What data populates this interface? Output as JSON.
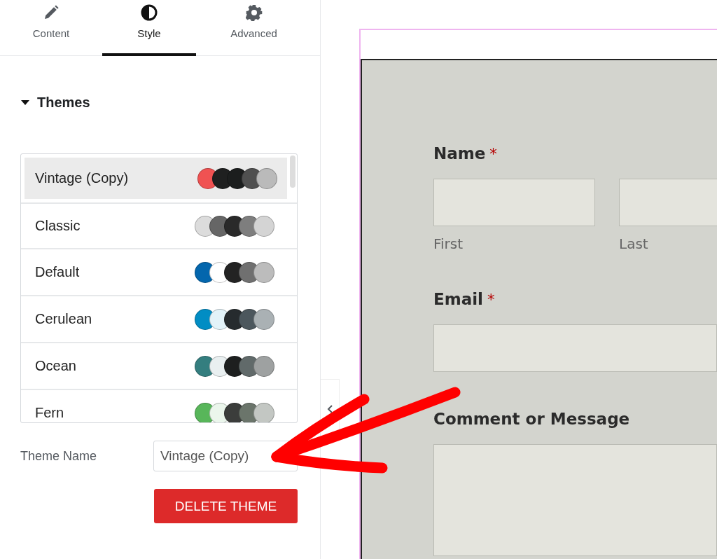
{
  "tabs": [
    {
      "label": "Content",
      "selected": false
    },
    {
      "label": "Style",
      "selected": true
    },
    {
      "label": "Advanced",
      "selected": false
    }
  ],
  "section": {
    "title": "Themes",
    "expanded": true
  },
  "themes": [
    {
      "name": "Vintage (Copy)",
      "selected": true,
      "swatches": [
        {
          "color": "#f05252"
        },
        {
          "color": "#1f2020"
        },
        {
          "color": "#1c1e1e"
        },
        {
          "color": "#505050"
        },
        {
          "color": "#bababa"
        }
      ]
    },
    {
      "name": "Classic",
      "selected": false,
      "swatches": [
        {
          "color": "#dcdcdc"
        },
        {
          "color": "#666666"
        },
        {
          "color": "#2a2a2a"
        },
        {
          "color": "#7e7e7e"
        },
        {
          "color": "#d4d4d4"
        }
      ]
    },
    {
      "name": "Default",
      "selected": false,
      "swatches": [
        {
          "color": "#0366ad"
        },
        {
          "color": "#ffffff"
        },
        {
          "color": "#232323"
        },
        {
          "color": "#707070"
        },
        {
          "color": "#bcbcbc"
        }
      ]
    },
    {
      "name": "Cerulean",
      "selected": false,
      "swatches": [
        {
          "color": "#018dc4"
        },
        {
          "color": "#e3f3f9"
        },
        {
          "color": "#262b2e"
        },
        {
          "color": "#4c575d"
        },
        {
          "color": "#aab1b4"
        }
      ]
    },
    {
      "name": "Ocean",
      "selected": false,
      "swatches": [
        {
          "color": "#347e7f"
        },
        {
          "color": "#e9eff0"
        },
        {
          "color": "#1d1f1f"
        },
        {
          "color": "#616a6a"
        },
        {
          "color": "#9ea1a1"
        }
      ]
    },
    {
      "name": "Fern",
      "selected": false,
      "swatches": [
        {
          "color": "#58b65a"
        },
        {
          "color": "#ebf6ec"
        },
        {
          "color": "#3b3d3b"
        },
        {
          "color": "#6b756b"
        },
        {
          "color": "#c3c7c3"
        }
      ]
    }
  ],
  "theme_name": {
    "label": "Theme Name",
    "value": "Vintage (Copy)"
  },
  "delete_button": "DELETE THEME",
  "form": {
    "fields": [
      {
        "kind": "split",
        "label": "Name",
        "required_mark": "*",
        "sublabels": [
          "First",
          "Last"
        ]
      },
      {
        "kind": "single",
        "label": "Email",
        "required_mark": "*"
      },
      {
        "kind": "textarea",
        "label": "Comment or Message"
      }
    ]
  }
}
